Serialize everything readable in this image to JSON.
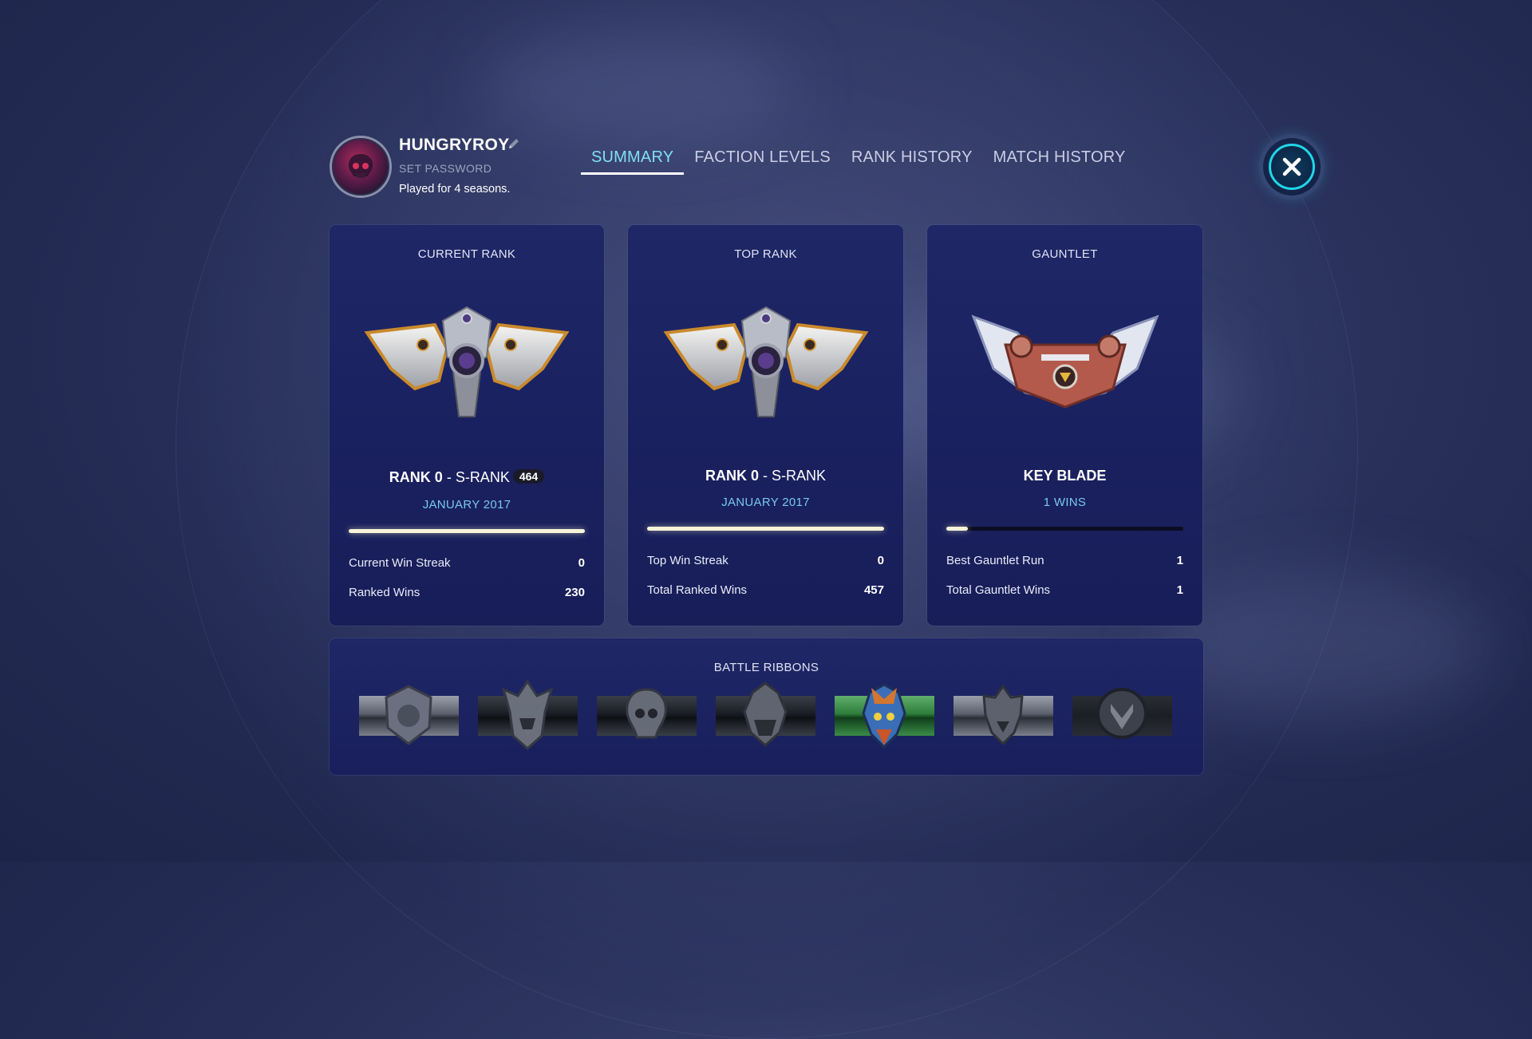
{
  "profile": {
    "username": "HUNGRYROY",
    "set_password": "SET PASSWORD",
    "seasons_text": "Played for 4 seasons."
  },
  "tabs": [
    {
      "label": "SUMMARY",
      "active": true
    },
    {
      "label": "FACTION LEVELS",
      "active": false
    },
    {
      "label": "RANK HISTORY",
      "active": false
    },
    {
      "label": "MATCH HISTORY",
      "active": false
    }
  ],
  "cards": {
    "current_rank": {
      "title": "CURRENT RANK",
      "rank_bold": "RANK 0",
      "rank_sep": " - ",
      "rank_tier": "S-RANK",
      "points": "464",
      "date": "JANUARY 2017",
      "progress": 1.0,
      "stats": [
        {
          "label": "Current Win Streak",
          "value": "0"
        },
        {
          "label": "Ranked Wins",
          "value": "230"
        }
      ]
    },
    "top_rank": {
      "title": "TOP RANK",
      "rank_bold": "RANK 0",
      "rank_sep": " - ",
      "rank_tier": "S-RANK",
      "date": "JANUARY 2017",
      "progress": 1.0,
      "stats": [
        {
          "label": "Top Win Streak",
          "value": "0"
        },
        {
          "label": "Total Ranked Wins",
          "value": "457"
        }
      ]
    },
    "gauntlet": {
      "title": "GAUNTLET",
      "rank_bold": "KEY BLADE",
      "date": "1 WINS",
      "progress": 0.09,
      "stats": [
        {
          "label": "Best Gauntlet Run",
          "value": "1"
        },
        {
          "label": "Total Gauntlet Wins",
          "value": "1"
        }
      ]
    }
  },
  "ribbons": {
    "title": "BATTLE RIBBONS",
    "items": [
      "knight-ribbon-icon",
      "samurai-ribbon-icon",
      "skull-ribbon-icon",
      "viking-ribbon-icon",
      "warborn-ribbon-icon",
      "wolf-ribbon-icon",
      "shield-ribbon-icon"
    ]
  },
  "colors": {
    "accent_tab": "#7fe0f0",
    "date_text": "#79c8ec",
    "close_ring": "#1fd6e8",
    "progress_fill": "#f6f3d9"
  }
}
